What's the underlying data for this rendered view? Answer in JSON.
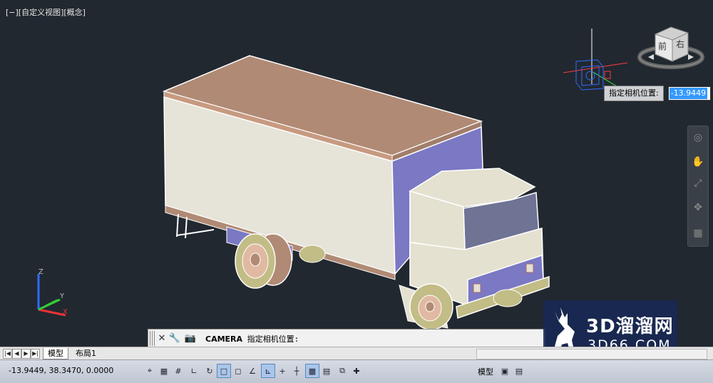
{
  "viewport": {
    "label": "[−][自定义视图][概念]",
    "background": "#212830"
  },
  "viewcube": {
    "front_label": "前",
    "right_label": "右"
  },
  "dynamic_prompt": {
    "label": "指定相机位置:",
    "value": "-13.9449"
  },
  "ucs": {
    "x": "X",
    "y": "Y",
    "z": "Z"
  },
  "command_line": {
    "command": "CAMERA",
    "prompt": "指定相机位置:"
  },
  "tabs": {
    "model": "模型",
    "layout1": "布局1",
    "nav_icons": [
      "first-icon",
      "prev-icon",
      "next-icon",
      "last-icon"
    ]
  },
  "status": {
    "coordinates": "-13.9449, 38.3470, 0.0000",
    "model_label": "模型"
  },
  "watermark": {
    "title": "3D溜溜网",
    "subtitle": "3D66.COM"
  },
  "colors": {
    "truck_roof": "#b08a74",
    "truck_side": "#e6e3d8",
    "truck_front_box": "#7b78c4",
    "cab_body": "#e4e1d1",
    "cab_window": "#b9b77c",
    "cab_front_window": "#6f7394",
    "selection_blue": "#3399ff",
    "watermark_bg": "#182854"
  }
}
